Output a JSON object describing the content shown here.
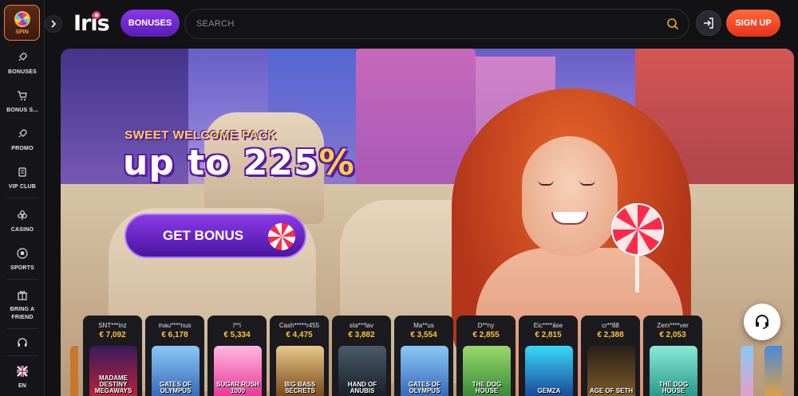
{
  "sidebar": {
    "spin_label": "SPIN",
    "items": [
      {
        "label": "BONUSES",
        "icon": "rocket-icon"
      },
      {
        "label": "BONUS S...",
        "icon": "cart-icon"
      },
      {
        "label": "PROMO",
        "icon": "rocket-icon"
      },
      {
        "label": "VIP CLUB",
        "icon": "vip-icon"
      },
      {
        "label": "CASINO",
        "icon": "clover-icon"
      },
      {
        "label": "SPORTS",
        "icon": "soccer-ball-icon"
      },
      {
        "label": "BRING A FRIEND",
        "icon": "gift-icon"
      },
      {
        "label": "",
        "icon": "headset-icon"
      },
      {
        "label": "EN",
        "icon": "uk-flag-icon"
      }
    ]
  },
  "header": {
    "logo": "Iris",
    "bonuses_label": "BONUSES",
    "search_placeholder": "SEARCH",
    "signup_label": "SIGN UP"
  },
  "hero": {
    "pack_title": "SWEET WELCOME PACK",
    "amount_prefix": "up to 225",
    "amount_percent": "%",
    "cta_label": "GET BONUS"
  },
  "winners": [
    {
      "user": "SNT***inz",
      "amount": "€ 7,092",
      "game": "MADAME DESTINY MEGAWAYS",
      "color": "#b8243c"
    },
    {
      "user": "mau****nus",
      "amount": "€ 6,178",
      "game": "GATES OF OLYMPUS",
      "color": "#4a8ad8"
    },
    {
      "user": "l**i",
      "amount": "€ 5,334",
      "game": "SUGAR RUSH 1000",
      "color": "#ff6ab8"
    },
    {
      "user": "Cash*****r455",
      "amount": "€ 4,475",
      "game": "BIG BASS SECRETS",
      "color": "#c88a3a"
    },
    {
      "user": "sta***lav",
      "amount": "€ 3,882",
      "game": "HAND OF ANUBIS",
      "color": "#2a3a4a"
    },
    {
      "user": "Ma**us",
      "amount": "€ 3,554",
      "game": "GATES OF OLYMPUS",
      "color": "#4a8ad8"
    },
    {
      "user": "D**ny",
      "amount": "€ 2,855",
      "game": "THE DOG HOUSE",
      "color": "#3a9a4a"
    },
    {
      "user": "Eic****äse",
      "amount": "€ 2,815",
      "game": "GEMZA",
      "color": "#1a8ab8"
    },
    {
      "user": "cr**88",
      "amount": "€ 2,388",
      "game": "AGE OF SETH",
      "color": "#5a4a2a"
    },
    {
      "user": "Zem****ver",
      "amount": "€ 2,053",
      "game": "THE DOG HOUSE",
      "color": "#3ab8a8"
    }
  ],
  "colors": {
    "accent_purple": "#7a2ee0",
    "accent_orange": "#ff5a2a",
    "win_amount": "#ffc23a"
  }
}
